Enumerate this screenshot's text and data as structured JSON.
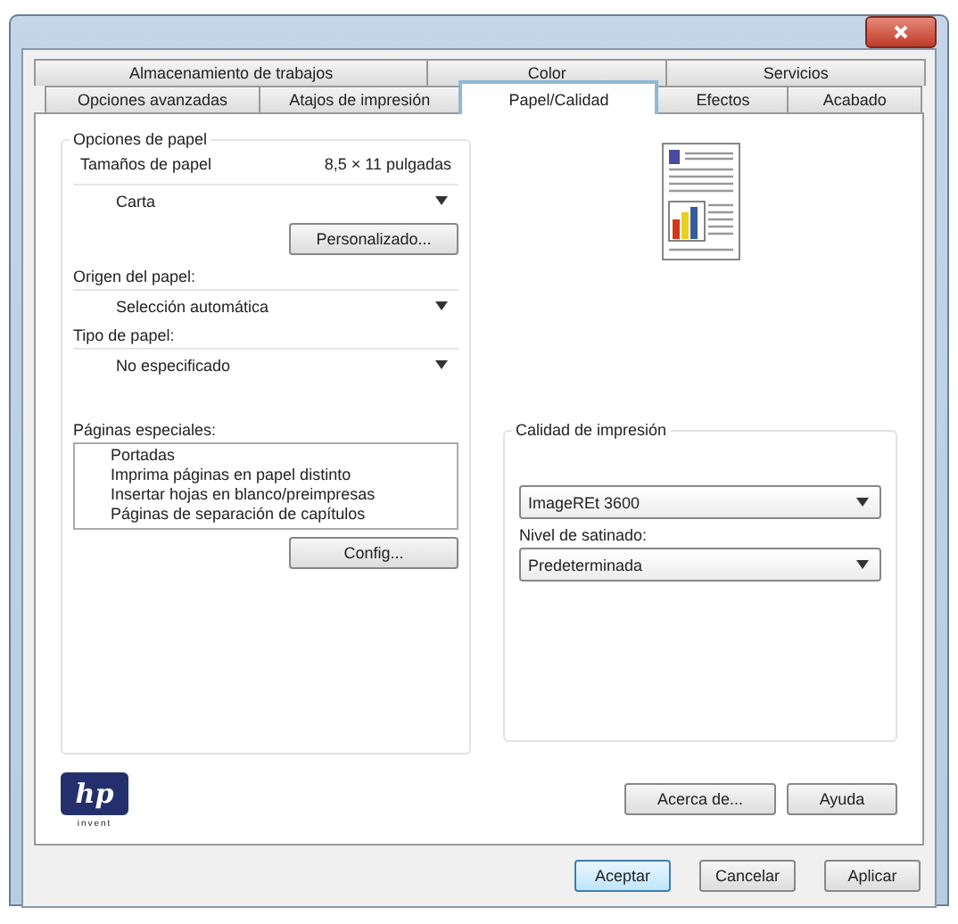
{
  "tabs_row_1": [
    {
      "label": "Almacenamiento de trabajos",
      "selected": false
    },
    {
      "label": "Color",
      "selected": false
    },
    {
      "label": "Servicios",
      "selected": false
    }
  ],
  "tabs_row_2": [
    {
      "label": "Opciones avanzadas",
      "selected": false
    },
    {
      "label": "Atajos de impresión",
      "selected": false
    },
    {
      "label": "Papel/Calidad",
      "selected": true
    },
    {
      "label": "Efectos",
      "selected": false
    },
    {
      "label": "Acabado",
      "selected": false
    }
  ],
  "paper_options": {
    "title": "Opciones de papel",
    "size_label": "Tamaños de papel",
    "size_value": "8,5 × 11 pulgadas",
    "size_select": "Carta",
    "custom_button": "Personalizado...",
    "source_label": "Origen del papel:",
    "source_select": "Selección automática",
    "type_label": "Tipo de papel:",
    "type_select": "No especificado"
  },
  "special_pages": {
    "label": "Páginas especiales:",
    "items": [
      "Portadas",
      "Imprima páginas en papel distinto",
      "Insertar hojas en blanco/preimpresas",
      "Páginas de separación de capítulos"
    ],
    "config_button": "Config..."
  },
  "print_quality": {
    "title": "Calidad de impresión",
    "quality_select": "ImageREt 3600",
    "gloss_label": "Nivel de satinado:",
    "gloss_select": "Predeterminada"
  },
  "logo": {
    "text": "hp",
    "tagline": "invent"
  },
  "panel_buttons": [
    "Acerca de...",
    "Ayuda"
  ],
  "dialog_buttons": [
    {
      "label": "Aceptar",
      "kind": "default"
    },
    {
      "label": "Cancelar",
      "kind": "normal"
    },
    {
      "label": "Aplicar",
      "kind": "normal"
    }
  ]
}
